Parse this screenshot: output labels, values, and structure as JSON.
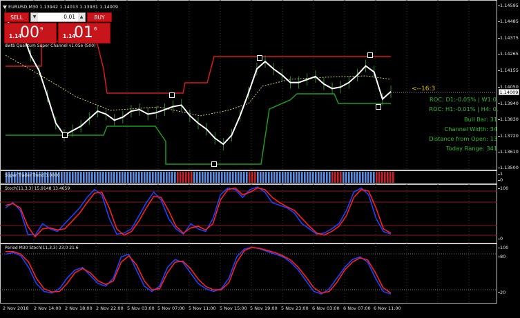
{
  "chart_header": {
    "symbol_line": "EURUSD,M30  1.13942 1.14013 1.13931 1.14009"
  },
  "trade_panel": {
    "sell_label": "SELL",
    "buy_label": "BUY",
    "lot_value": "0.01",
    "sell_price_prefix": "1.14",
    "sell_price_big": "00",
    "sell_price_sup": "9",
    "buy_price_prefix": "1.14",
    "buy_price_big": "01",
    "buy_price_sup": "6"
  },
  "indicator_label": "dwtb Quantum Super Channel v1.05e (500)",
  "annotation_arrow": "<--16:3",
  "stats": {
    "roc1": "ROC: D1:-0.05% | W1:0.13%",
    "roc2": "ROC: H1:-0.01% | H4: 0.04%",
    "bull_bar": "Bull Bar: 31 pips",
    "channel_width": "Channel Width: 34 pips",
    "distance": "Distance from Open: 13 pips",
    "today_range": "Today Range: 341 pips"
  },
  "price_axis": {
    "ticks": [
      "1.14595",
      "1.14485",
      "1.14375",
      "1.14265",
      "1.14155",
      "1.14050",
      "1.13940",
      "1.13830",
      "1.13720",
      "1.13610",
      "1.13500"
    ],
    "current_price": "1.14009"
  },
  "trend_pane": {
    "label": "Super Trader Trend 3.0000",
    "axis_top": "1",
    "axis_bottom": "0"
  },
  "stoch_pane": {
    "label": "Stoch(11,3,3) 15.9148 13.4659",
    "axis_top": "100",
    "axis_bottom": "0"
  },
  "period_stoch_pane": {
    "label": "Period M30 Stoch(11,3,3) 23.0 21.6",
    "axis_100": "100",
    "axis_80": "80",
    "axis_20": "20"
  },
  "time_axis": [
    "2 Nov 2018",
    "2 Nov 14:00",
    "2 Nov 18:00",
    "2 Nov 22:00",
    "5 Nov 03:00",
    "5 Nov 07:00",
    "5 Nov 11:00",
    "5 Nov 15:00",
    "5 Nov 19:00",
    "5 Nov 23:00",
    "6 Nov 03:00",
    "6 Nov 07:00",
    "6 Nov 11:00"
  ],
  "colors": {
    "upper_channel": "#d81b1b",
    "lower_channel": "#1f9a1f",
    "price_line": "#ffffff",
    "stoch_main": "#2040ff",
    "stoch_signal": "#ff2020",
    "stats_text": "#2fbd2f",
    "arrow_text": "#e8c300",
    "trade_red": "#c8151b"
  },
  "chart_data": {
    "type": "line",
    "title": "EURUSD,M30",
    "ylim": [
      1.135,
      1.146
    ],
    "series": [
      {
        "name": "price",
        "values": [
          1.1452,
          1.1438,
          1.144,
          1.1425,
          1.1415,
          1.1398,
          1.138,
          1.1372,
          1.1375,
          1.1378,
          1.1383,
          1.1388,
          1.1386,
          1.1382,
          1.1384,
          1.1388,
          1.1389,
          1.1386,
          1.1387,
          1.1389,
          1.1391,
          1.1392,
          1.1385,
          1.138,
          1.1376,
          1.137,
          1.1366,
          1.1372,
          1.1385,
          1.14,
          1.1416,
          1.1421,
          1.1416,
          1.1412,
          1.1407,
          1.1407,
          1.1409,
          1.1411,
          1.1406,
          1.1403,
          1.1404,
          1.1407,
          1.1412,
          1.1418,
          1.1414,
          1.1396,
          1.1401
        ]
      }
    ]
  }
}
